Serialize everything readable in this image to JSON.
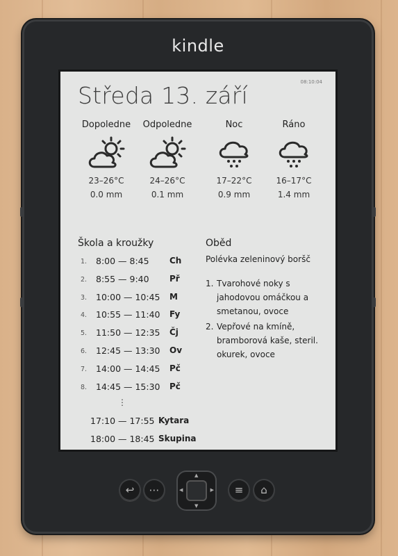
{
  "device": {
    "brand": "kindle"
  },
  "screen": {
    "clock": "08:10:04",
    "date_title": "Středa 13. září",
    "weather": [
      {
        "label": "Dopoledne",
        "icon": "partly-cloudy-icon",
        "temp": "23–26°C",
        "rain": "0.0 mm"
      },
      {
        "label": "Odpoledne",
        "icon": "partly-cloudy-icon",
        "temp": "24–26°C",
        "rain": "0.1 mm"
      },
      {
        "label": "Noc",
        "icon": "rain-cloud-icon",
        "temp": "17–22°C",
        "rain": "0.9 mm"
      },
      {
        "label": "Ráno",
        "icon": "rain-cloud-icon",
        "temp": "16–17°C",
        "rain": "1.4 mm"
      }
    ],
    "schedule": {
      "title": "Škola a kroužky",
      "rows": [
        {
          "num": "1.",
          "time": "8:00 —   8:45",
          "subject": "Ch"
        },
        {
          "num": "2.",
          "time": "8:55 —   9:40",
          "subject": "Př"
        },
        {
          "num": "3.",
          "time": "10:00 — 10:45",
          "subject": "M"
        },
        {
          "num": "4.",
          "time": "10:55 — 11:40",
          "subject": "Fy"
        },
        {
          "num": "5.",
          "time": "11:50 — 12:35",
          "subject": "Čj"
        },
        {
          "num": "6.",
          "time": "12:45 — 13:30",
          "subject": "Ov"
        },
        {
          "num": "7.",
          "time": "14:00 — 14:45",
          "subject": "Pč"
        },
        {
          "num": "8.",
          "time": "14:45 — 15:30",
          "subject": "Pč"
        }
      ],
      "ellipsis": "⋮",
      "extras": [
        {
          "time": "17:10 — 17:55",
          "subject": "Kytara"
        },
        {
          "time": "18:00 — 18:45",
          "subject": "Skupina"
        }
      ]
    },
    "lunch": {
      "title": "Oběd",
      "soup": "Polévka zeleninový boršč",
      "items": [
        {
          "num": "1.",
          "text": "Tvarohové noky s jahodovou omáčkou a smetanou, ovoce"
        },
        {
          "num": "2.",
          "text": "Vepřové na kmíně, bramborová kaše, steril. okurek, ovoce"
        }
      ]
    }
  },
  "controls": {
    "back_icon": "↩",
    "keyboard_icon": "⋯",
    "menu_icon": "≡",
    "home_icon": "⌂"
  }
}
